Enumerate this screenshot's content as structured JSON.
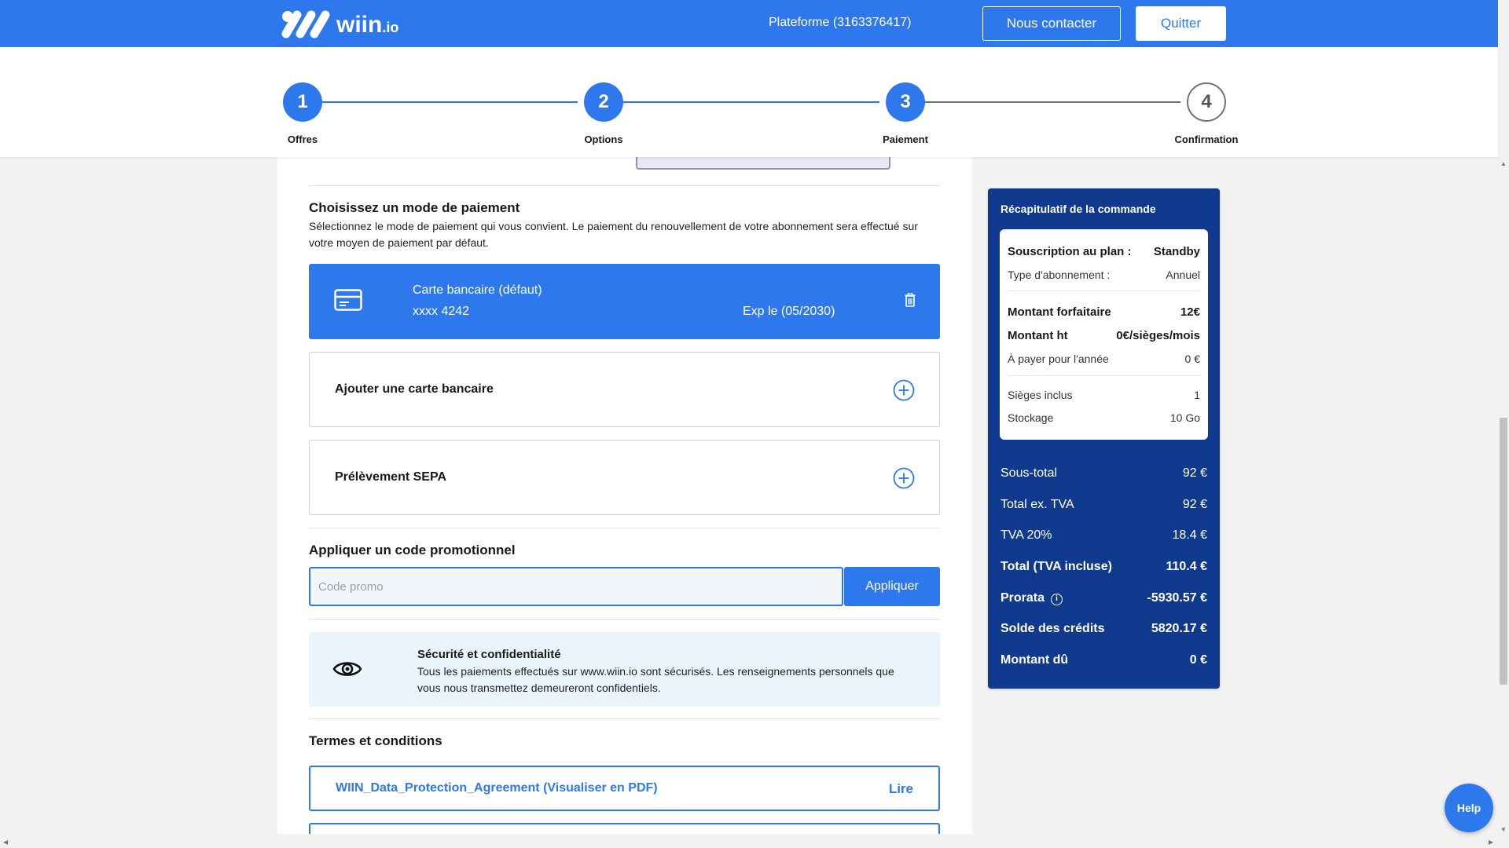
{
  "header": {
    "logo_text": "wiin",
    "logo_suffix": ".io",
    "platform": "Plateforme (3163376417)",
    "contact_label": "Nous contacter",
    "quit_label": "Quitter",
    "bg_color": "#2d78ec"
  },
  "stepper": {
    "steps": [
      {
        "number": "1",
        "label": "Offres",
        "state": "done"
      },
      {
        "number": "2",
        "label": "Options",
        "state": "done"
      },
      {
        "number": "3",
        "label": "Paiement",
        "state": "current"
      },
      {
        "number": "4",
        "label": "Confirmation",
        "state": "todo"
      }
    ]
  },
  "payment": {
    "title": "Choisissez un mode de paiement",
    "description": "Sélectionnez le mode de paiement qui vous convient. Le paiement du renouvellement de votre abonnement sera effectué sur votre moyen de paiement par défaut.",
    "default_card": {
      "name": "Carte bancaire (défaut)",
      "number": "xxxx 4242",
      "expiry": "Exp le (05/2030)",
      "icon": "credit-card-icon"
    },
    "add_card_label": "Ajouter une carte bancaire",
    "sepa_label": "Prélèvement SEPA"
  },
  "promo": {
    "title": "Appliquer un code promotionnel",
    "placeholder": "Code promo",
    "button_label": "Appliquer"
  },
  "security": {
    "title": "Sécurité et confidentialité",
    "text": "Tous les paiements effectués sur www.wiin.io sont sécurisés. Les renseignements personnels que vous nous transmettez demeureront confidentiels."
  },
  "terms": {
    "title": "Termes et conditions",
    "documents": [
      {
        "name": "WIIN_Data_Protection_Agreement (Visualiser en PDF)",
        "action": "Lire"
      }
    ]
  },
  "summary": {
    "title": "Récapitulatif de la commande",
    "plan_label": "Souscription au plan :",
    "plan_value": "Standby",
    "sub_type_label": "Type d'abonnement :",
    "sub_type_value": "Annuel",
    "flat_label": "Montant forfaitaire",
    "flat_value": "12€",
    "ht_label": "Montant ht",
    "ht_value": "0€/sièges/mois",
    "year_label": "À payer pour l'année",
    "year_value": "0 €",
    "seats_label": "Sièges inclus",
    "seats_value": "1",
    "storage_label": "Stockage",
    "storage_value": "10 Go",
    "subtotal_label": "Sous-total",
    "subtotal_value": "92 €",
    "total_ex_label": "Total ex. TVA",
    "total_ex_value": "92 €",
    "tva_label": "TVA 20%",
    "tva_value": "18.4 €",
    "total_inc_label": "Total (TVA incluse)",
    "total_inc_value": "110.4 €",
    "prorata_label": "Prorata",
    "prorata_value": "-5930.57 €",
    "credits_label": "Solde des crédits",
    "credits_value": "5820.17 €",
    "due_label": "Montant dû",
    "due_value": "0 €",
    "bg_color": "#0f3a8e"
  },
  "help_label": "Help"
}
